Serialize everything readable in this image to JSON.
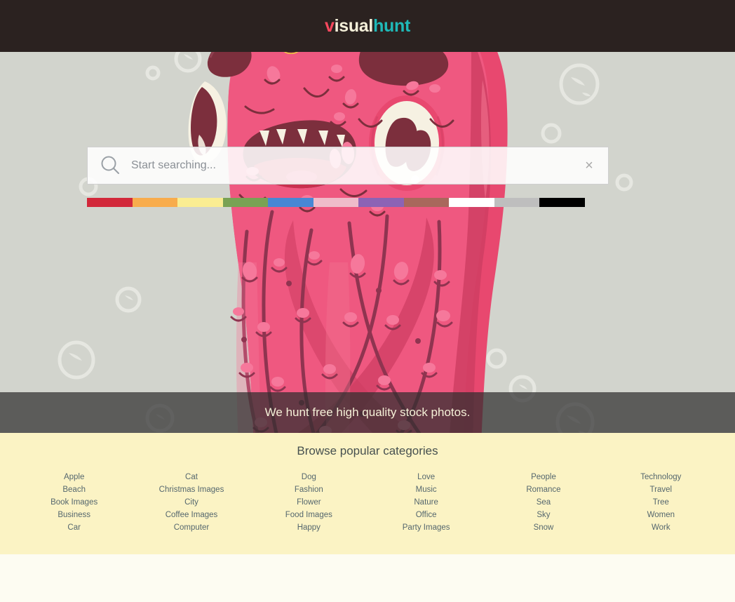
{
  "header": {
    "logo": {
      "part1": "v",
      "part2": "isual",
      "part3": "hunt",
      "color1": "#f8485e",
      "color2": "#f4efd9",
      "color3": "#1fb9b8"
    },
    "background": "#2b2220"
  },
  "hero": {
    "background": "#d2d4cd",
    "illustration_name": "pink-octopus-monster",
    "search": {
      "placeholder": "Start searching...",
      "value": "",
      "clear_label": "×",
      "search_icon": "search-icon"
    },
    "color_filters": [
      {
        "name": "red",
        "hex": "#d2283a"
      },
      {
        "name": "orange",
        "hex": "#f8ac4c"
      },
      {
        "name": "yellow",
        "hex": "#faed92"
      },
      {
        "name": "green",
        "hex": "#79a254"
      },
      {
        "name": "blue",
        "hex": "#4787d4"
      },
      {
        "name": "pink",
        "hex": "#efbbca"
      },
      {
        "name": "purple",
        "hex": "#8c63b5"
      },
      {
        "name": "brown",
        "hex": "#a9685c"
      },
      {
        "name": "white",
        "hex": "#ffffff"
      },
      {
        "name": "gray",
        "hex": "#bebebe"
      },
      {
        "name": "black",
        "hex": "#000000"
      }
    ],
    "tagline": "We hunt free high quality stock photos."
  },
  "categories": {
    "title": "Browse popular categories",
    "background": "#fbf3c4",
    "columns": [
      {
        "items": [
          "Apple",
          "Beach",
          "Book Images",
          "Business",
          "Car"
        ]
      },
      {
        "items": [
          "Cat",
          "Christmas Images",
          "City",
          "Coffee Images",
          "Computer"
        ]
      },
      {
        "items": [
          "Dog",
          "Fashion",
          "Flower",
          "Food Images",
          "Happy"
        ]
      },
      {
        "items": [
          "Love",
          "Music",
          "Nature",
          "Office",
          "Party Images"
        ]
      },
      {
        "items": [
          "People",
          "Romance",
          "Sea",
          "Sky",
          "Snow"
        ]
      },
      {
        "items": [
          "Technology",
          "Travel",
          "Tree",
          "Women",
          "Work"
        ]
      }
    ]
  }
}
